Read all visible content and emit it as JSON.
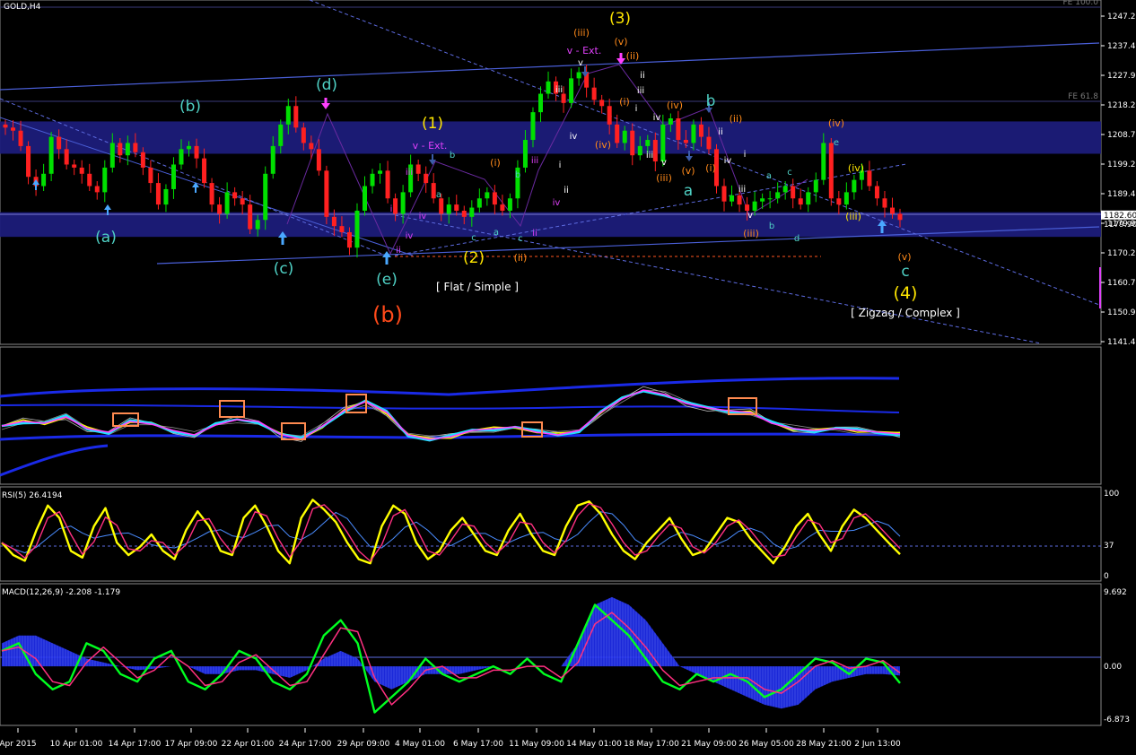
{
  "window": {
    "symbol_label": "GOLD,H4",
    "fe_top_label": "FE 100.0",
    "fe_mid_label": "FE 61.8",
    "current_price": "1182.60",
    "current_price_shadow": "1179.90"
  },
  "colors": {
    "background": "#000000",
    "bull_candle": "#00e000",
    "bear_candle": "#ff2020",
    "zone_fill": "#1c1c7a",
    "channel_line": "#4a5fd8",
    "dashed_line": "#5d6be0",
    "axis_text": "#ffffff",
    "label_teal": "#4fd1c5",
    "label_yellow": "#ffe600",
    "label_orange": "#ff8a1a",
    "label_red": "#ff4a1a",
    "label_magenta": "#e040fb",
    "label_white": "#ffffff",
    "label_blue": "#4aa8ff",
    "rsi_main": "#ffff00",
    "macd_hist": "#1e2cf0",
    "macd_line": "#00ff20",
    "macd_signal": "#ff3080"
  },
  "chart_data": [
    {
      "type": "candlestick",
      "panel": "price",
      "symbol": "GOLD",
      "timeframe": "H4",
      "ylim": [
        1141.46,
        1247.21
      ],
      "y_ticks": [
        "1247.21",
        "1237.46",
        "1227.96",
        "1218.21",
        "1208.71",
        "1199.21",
        "1189.46",
        "1179.96",
        "1170.21",
        "1160.71",
        "1150.96",
        "1141.46"
      ],
      "x_ticks": [
        "Apr 2015",
        "10 Apr 01:00",
        "14 Apr 17:00",
        "17 Apr 09:00",
        "22 Apr 01:00",
        "24 Apr 17:00",
        "29 Apr 09:00",
        "4 May 01:00",
        "6 May 17:00",
        "11 May 09:00",
        "14 May 01:00",
        "18 May 17:00",
        "21 May 09:00",
        "26 May 05:00",
        "28 May 21:00",
        "2 Jun 13:00"
      ],
      "supply_zone": [
        1202.5,
        1213.0
      ],
      "demand_zone": [
        1175.5,
        1183.5
      ],
      "close_path": [
        1211,
        1210,
        1205,
        1195,
        1192,
        1196,
        1208,
        1204,
        1199,
        1198,
        1196,
        1192,
        1190,
        1198,
        1206,
        1202,
        1206,
        1203,
        1198,
        1193,
        1186,
        1191,
        1199,
        1204,
        1205,
        1201,
        1193,
        1186,
        1183,
        1190,
        1188,
        1186,
        1178,
        1181,
        1196,
        1205,
        1212,
        1218,
        1211,
        1206,
        1204,
        1197,
        1182,
        1179,
        1177,
        1172,
        1184,
        1192,
        1196,
        1197,
        1188,
        1183,
        1190,
        1199,
        1196,
        1193,
        1188,
        1183,
        1186,
        1184,
        1182,
        1185,
        1188,
        1190,
        1186,
        1184,
        1188,
        1198,
        1207,
        1216,
        1222,
        1226,
        1222,
        1219,
        1227,
        1229,
        1224,
        1220,
        1218,
        1212,
        1206,
        1210,
        1202,
        1205,
        1207,
        1200,
        1212,
        1214,
        1207,
        1206,
        1212,
        1208,
        1204,
        1192,
        1187,
        1189,
        1186,
        1184,
        1187,
        1188,
        1188,
        1190,
        1192,
        1188,
        1186,
        1190,
        1194,
        1206,
        1188,
        1186,
        1190,
        1194,
        1197,
        1192,
        1188,
        1185,
        1183,
        1181
      ],
      "wave_labels": [
        "(a)",
        "(b)",
        "(c)",
        "(d)",
        "(e)",
        "(b)",
        "(1)",
        "v - Ext.",
        "(2)",
        "[ Flat / Simple ]",
        "(3)",
        "(iii)",
        "v - Ext.",
        "(v)",
        "(ii)",
        "(i)",
        "(iv)",
        "b",
        "a",
        "(4)",
        "c",
        "[ Zigzag / Complex ]",
        "(iv)",
        "(v)",
        "(ii)",
        "(iii)",
        "(i)",
        "(iv)",
        "(iii)",
        "(i)",
        "(ii)",
        "(iii)",
        "(ii)",
        "(iv)",
        "(v)",
        "(iii)",
        "(ii)",
        "(i)"
      ],
      "minor_labels": [
        "i",
        "ii",
        "iii",
        "iv",
        "v",
        "a",
        "b",
        "c",
        "d",
        "e"
      ]
    },
    {
      "type": "line",
      "panel": "oscillator_bands",
      "series": [
        {
          "values": [
            0.45,
            0.5,
            0.48,
            0.55,
            0.42,
            0.38,
            0.5,
            0.47,
            0.4,
            0.35,
            0.46,
            0.52,
            0.5,
            0.36,
            0.3,
            0.45,
            0.62,
            0.72,
            0.6,
            0.35,
            0.3,
            0.33,
            0.4,
            0.42,
            0.44,
            0.38,
            0.35,
            0.4,
            0.6,
            0.75,
            0.85,
            0.8,
            0.7,
            0.65,
            0.62,
            0.6,
            0.48,
            0.42,
            0.4,
            0.42,
            0.4,
            0.38,
            0.36
          ]
        }
      ]
    },
    {
      "type": "line",
      "panel": "rsi",
      "title": "RSI(5) 26.4194",
      "ylim": [
        0,
        100
      ],
      "y_ticks": [
        "100",
        "37",
        "0"
      ],
      "level": 37,
      "series": [
        {
          "values": [
            40,
            25,
            18,
            55,
            85,
            70,
            30,
            22,
            60,
            82,
            40,
            25,
            35,
            50,
            30,
            20,
            55,
            78,
            60,
            30,
            25,
            70,
            85,
            60,
            30,
            15,
            70,
            92,
            80,
            65,
            40,
            20,
            15,
            60,
            85,
            75,
            40,
            20,
            30,
            55,
            70,
            50,
            30,
            25,
            55,
            75,
            50,
            30,
            25,
            60,
            85,
            90,
            75,
            50,
            30,
            20,
            40,
            55,
            70,
            45,
            25,
            30,
            50,
            70,
            65,
            45,
            30,
            15,
            35,
            60,
            75,
            50,
            30,
            60,
            80,
            70,
            55,
            40,
            26
          ]
        }
      ]
    },
    {
      "type": "line",
      "panel": "macd",
      "title": "MACD(12,26,9) -2.208 -1.179",
      "ylim": [
        -6.873,
        9.692
      ],
      "y_ticks": [
        "9.692",
        "0.00",
        "-6.873"
      ],
      "series": [
        {
          "values": [
            2,
            3,
            -1,
            -3,
            -2,
            3,
            2,
            -1,
            -2,
            1,
            2,
            -2,
            -3,
            -1,
            2,
            1,
            -2,
            -3,
            -1,
            4,
            6,
            3,
            -6,
            -4,
            -2,
            1,
            -1,
            -2,
            -1,
            0,
            -1,
            1,
            -1,
            -2,
            3,
            8,
            6,
            4,
            1,
            -2,
            -3,
            -1,
            -2,
            -1,
            -2,
            -4,
            -3,
            -1,
            1,
            0.5,
            -1,
            1,
            0.5,
            -2.2
          ]
        },
        {
          "values": [
            3,
            4,
            4,
            3,
            2,
            1,
            0.5,
            0,
            -0.5,
            -0.3,
            0,
            0,
            -1,
            -1,
            -0.5,
            -0.5,
            -1,
            -1.5,
            -0.5,
            1,
            2,
            1,
            -2,
            -3,
            -2,
            -1,
            -1,
            -1,
            -0.5,
            0,
            0,
            0,
            0,
            0,
            3,
            8,
            9,
            8,
            6,
            3,
            0,
            -1,
            -2,
            -3,
            -4,
            -5,
            -5.5,
            -5,
            -3,
            -2,
            -1.5,
            -1,
            -1,
            -1.2
          ]
        }
      ]
    }
  ]
}
